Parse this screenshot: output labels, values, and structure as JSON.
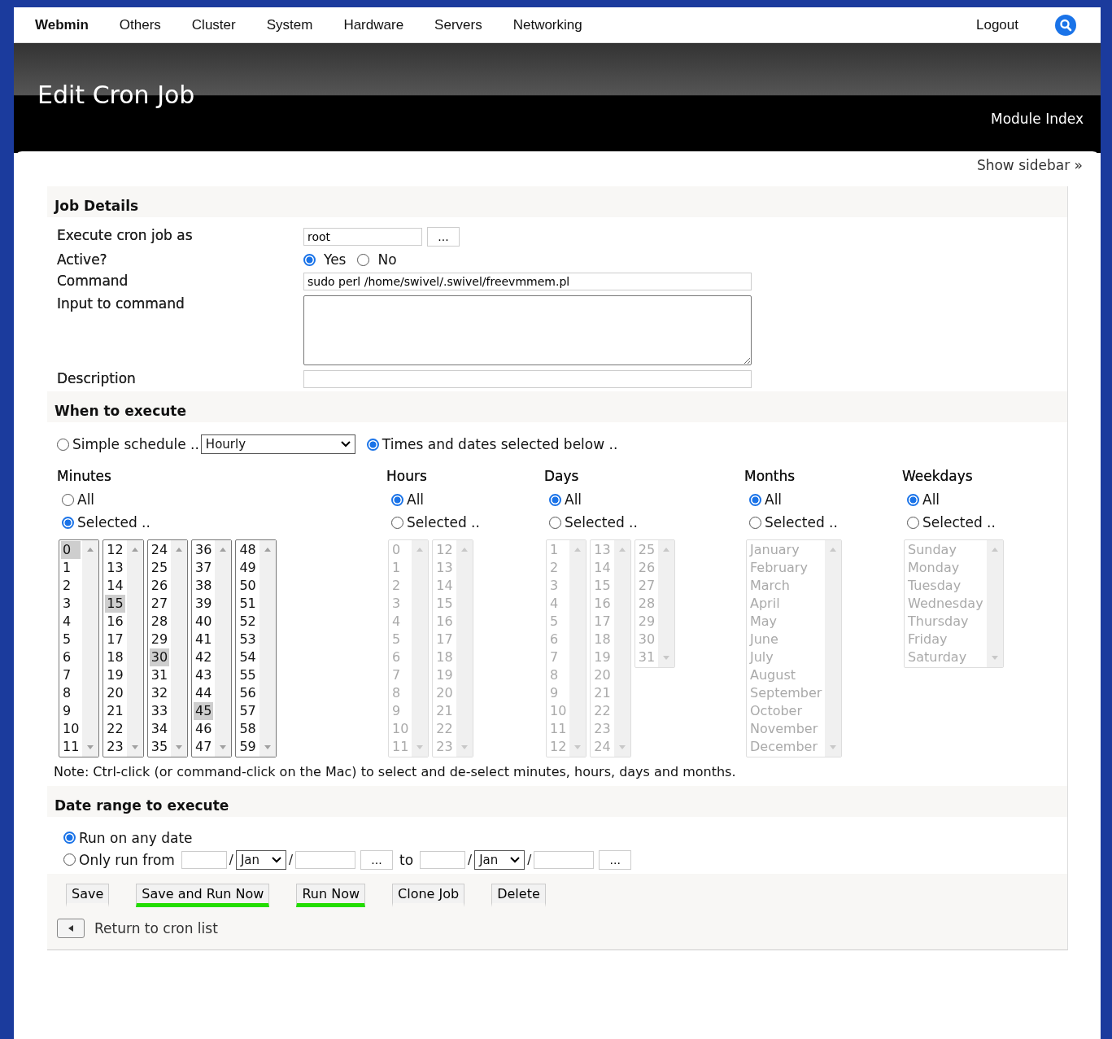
{
  "topnav": {
    "brand": "Webmin",
    "items": [
      "Others",
      "Cluster",
      "System",
      "Hardware",
      "Servers",
      "Networking"
    ],
    "logout": "Logout"
  },
  "header": {
    "title": "Edit Cron Job",
    "link": "Module Index"
  },
  "show_sidebar": "Show sidebar »",
  "job_details": {
    "heading": "Job Details",
    "user": {
      "label": "Execute cron job as",
      "value": "root",
      "button": "..."
    },
    "active": {
      "label": "Active?",
      "options": [
        {
          "label": "Yes",
          "selected": true
        },
        {
          "label": "No",
          "selected": false
        }
      ]
    },
    "command": {
      "label": "Command",
      "value": "sudo perl /home/swivel/.swivel/freevmmem.pl"
    },
    "input": {
      "label": "Input to command"
    },
    "description": {
      "label": "Description"
    }
  },
  "schedule": {
    "heading": "When to execute",
    "modes": [
      {
        "label": "Simple schedule ..",
        "selected": false,
        "dropdown": "Hourly"
      },
      {
        "label": "Times and dates selected below ..",
        "selected": true
      }
    ],
    "groups": [
      {
        "title": "Minutes",
        "disabled": false,
        "options": [
          {
            "label": "All",
            "selected": false
          },
          {
            "label": "Selected ..",
            "selected": true
          }
        ],
        "lists": [
          [
            {
              "label": "0",
              "selected": true
            },
            {
              "label": "1",
              "selected": false
            },
            {
              "label": "2",
              "selected": false
            },
            {
              "label": "3",
              "selected": false
            },
            {
              "label": "4",
              "selected": false
            },
            {
              "label": "5",
              "selected": false
            },
            {
              "label": "6",
              "selected": false
            },
            {
              "label": "7",
              "selected": false
            },
            {
              "label": "8",
              "selected": false
            },
            {
              "label": "9",
              "selected": false
            },
            {
              "label": "10",
              "selected": false
            },
            {
              "label": "11",
              "selected": false
            }
          ],
          [
            {
              "label": "12",
              "selected": false
            },
            {
              "label": "13",
              "selected": false
            },
            {
              "label": "14",
              "selected": false
            },
            {
              "label": "15",
              "selected": true
            },
            {
              "label": "16",
              "selected": false
            },
            {
              "label": "17",
              "selected": false
            },
            {
              "label": "18",
              "selected": false
            },
            {
              "label": "19",
              "selected": false
            },
            {
              "label": "20",
              "selected": false
            },
            {
              "label": "21",
              "selected": false
            },
            {
              "label": "22",
              "selected": false
            },
            {
              "label": "23",
              "selected": false
            }
          ],
          [
            {
              "label": "24",
              "selected": false
            },
            {
              "label": "25",
              "selected": false
            },
            {
              "label": "26",
              "selected": false
            },
            {
              "label": "27",
              "selected": false
            },
            {
              "label": "28",
              "selected": false
            },
            {
              "label": "29",
              "selected": false
            },
            {
              "label": "30",
              "selected": true
            },
            {
              "label": "31",
              "selected": false
            },
            {
              "label": "32",
              "selected": false
            },
            {
              "label": "33",
              "selected": false
            },
            {
              "label": "34",
              "selected": false
            },
            {
              "label": "35",
              "selected": false
            }
          ],
          [
            {
              "label": "36",
              "selected": false
            },
            {
              "label": "37",
              "selected": false
            },
            {
              "label": "38",
              "selected": false
            },
            {
              "label": "39",
              "selected": false
            },
            {
              "label": "40",
              "selected": false
            },
            {
              "label": "41",
              "selected": false
            },
            {
              "label": "42",
              "selected": false
            },
            {
              "label": "43",
              "selected": false
            },
            {
              "label": "44",
              "selected": false
            },
            {
              "label": "45",
              "selected": true
            },
            {
              "label": "46",
              "selected": false
            },
            {
              "label": "47",
              "selected": false
            }
          ],
          [
            {
              "label": "48",
              "selected": false
            },
            {
              "label": "49",
              "selected": false
            },
            {
              "label": "50",
              "selected": false
            },
            {
              "label": "51",
              "selected": false
            },
            {
              "label": "52",
              "selected": false
            },
            {
              "label": "53",
              "selected": false
            },
            {
              "label": "54",
              "selected": false
            },
            {
              "label": "55",
              "selected": false
            },
            {
              "label": "56",
              "selected": false
            },
            {
              "label": "57",
              "selected": false
            },
            {
              "label": "58",
              "selected": false
            },
            {
              "label": "59",
              "selected": false
            }
          ]
        ]
      },
      {
        "title": "Hours",
        "disabled": true,
        "options": [
          {
            "label": "All",
            "selected": true
          },
          {
            "label": "Selected ..",
            "selected": false
          }
        ],
        "lists": [
          [
            {
              "label": "0",
              "selected": false
            },
            {
              "label": "1",
              "selected": false
            },
            {
              "label": "2",
              "selected": false
            },
            {
              "label": "3",
              "selected": false
            },
            {
              "label": "4",
              "selected": false
            },
            {
              "label": "5",
              "selected": false
            },
            {
              "label": "6",
              "selected": false
            },
            {
              "label": "7",
              "selected": false
            },
            {
              "label": "8",
              "selected": false
            },
            {
              "label": "9",
              "selected": false
            },
            {
              "label": "10",
              "selected": false
            },
            {
              "label": "11",
              "selected": false
            }
          ],
          [
            {
              "label": "12",
              "selected": false
            },
            {
              "label": "13",
              "selected": false
            },
            {
              "label": "14",
              "selected": false
            },
            {
              "label": "15",
              "selected": false
            },
            {
              "label": "16",
              "selected": false
            },
            {
              "label": "17",
              "selected": false
            },
            {
              "label": "18",
              "selected": false
            },
            {
              "label": "19",
              "selected": false
            },
            {
              "label": "20",
              "selected": false
            },
            {
              "label": "21",
              "selected": false
            },
            {
              "label": "22",
              "selected": false
            },
            {
              "label": "23",
              "selected": false
            }
          ]
        ]
      },
      {
        "title": "Days",
        "disabled": true,
        "options": [
          {
            "label": "All",
            "selected": true
          },
          {
            "label": "Selected ..",
            "selected": false
          }
        ],
        "lists": [
          [
            {
              "label": "1",
              "selected": false
            },
            {
              "label": "2",
              "selected": false
            },
            {
              "label": "3",
              "selected": false
            },
            {
              "label": "4",
              "selected": false
            },
            {
              "label": "5",
              "selected": false
            },
            {
              "label": "6",
              "selected": false
            },
            {
              "label": "7",
              "selected": false
            },
            {
              "label": "8",
              "selected": false
            },
            {
              "label": "9",
              "selected": false
            },
            {
              "label": "10",
              "selected": false
            },
            {
              "label": "11",
              "selected": false
            },
            {
              "label": "12",
              "selected": false
            }
          ],
          [
            {
              "label": "13",
              "selected": false
            },
            {
              "label": "14",
              "selected": false
            },
            {
              "label": "15",
              "selected": false
            },
            {
              "label": "16",
              "selected": false
            },
            {
              "label": "17",
              "selected": false
            },
            {
              "label": "18",
              "selected": false
            },
            {
              "label": "19",
              "selected": false
            },
            {
              "label": "20",
              "selected": false
            },
            {
              "label": "21",
              "selected": false
            },
            {
              "label": "22",
              "selected": false
            },
            {
              "label": "23",
              "selected": false
            },
            {
              "label": "24",
              "selected": false
            }
          ],
          [
            {
              "label": "25",
              "selected": false
            },
            {
              "label": "26",
              "selected": false
            },
            {
              "label": "27",
              "selected": false
            },
            {
              "label": "28",
              "selected": false
            },
            {
              "label": "29",
              "selected": false
            },
            {
              "label": "30",
              "selected": false
            },
            {
              "label": "31",
              "selected": false
            }
          ]
        ]
      },
      {
        "title": "Months",
        "disabled": true,
        "options": [
          {
            "label": "All",
            "selected": true
          },
          {
            "label": "Selected ..",
            "selected": false
          }
        ],
        "lists": [
          [
            {
              "label": "January",
              "selected": false
            },
            {
              "label": "February",
              "selected": false
            },
            {
              "label": "March",
              "selected": false
            },
            {
              "label": "April",
              "selected": false
            },
            {
              "label": "May",
              "selected": false
            },
            {
              "label": "June",
              "selected": false
            },
            {
              "label": "July",
              "selected": false
            },
            {
              "label": "August",
              "selected": false
            },
            {
              "label": "September",
              "selected": false
            },
            {
              "label": "October",
              "selected": false
            },
            {
              "label": "November",
              "selected": false
            },
            {
              "label": "December",
              "selected": false
            }
          ]
        ]
      },
      {
        "title": "Weekdays",
        "disabled": true,
        "options": [
          {
            "label": "All",
            "selected": true
          },
          {
            "label": "Selected ..",
            "selected": false
          }
        ],
        "lists": [
          [
            {
              "label": "Sunday",
              "selected": false
            },
            {
              "label": "Monday",
              "selected": false
            },
            {
              "label": "Tuesday",
              "selected": false
            },
            {
              "label": "Wednesday",
              "selected": false
            },
            {
              "label": "Thursday",
              "selected": false
            },
            {
              "label": "Friday",
              "selected": false
            },
            {
              "label": "Saturday",
              "selected": false
            }
          ]
        ]
      }
    ],
    "note": "Note: Ctrl-click (or command-click on the Mac) to select and de-select minutes, hours, days and months."
  },
  "date_range": {
    "heading": "Date range to execute",
    "options": [
      {
        "label": "Run on any date",
        "selected": true
      },
      {
        "label": "Only run from",
        "selected": false
      }
    ],
    "from": {
      "day_sep": "/",
      "month": "Jan",
      "year_sep": "/",
      "button": "..."
    },
    "to_label": "to",
    "to": {
      "day_sep": "/",
      "month": "Jan",
      "year_sep": "/",
      "button": "..."
    }
  },
  "buttons": [
    {
      "label": "Save",
      "highlighted": false
    },
    {
      "label": "Save and Run Now",
      "highlighted": true
    },
    {
      "label": "Run Now",
      "highlighted": true
    },
    {
      "label": "Clone Job",
      "highlighted": false
    },
    {
      "label": "Delete",
      "highlighted": false
    }
  ],
  "return_link": "Return to cron list"
}
